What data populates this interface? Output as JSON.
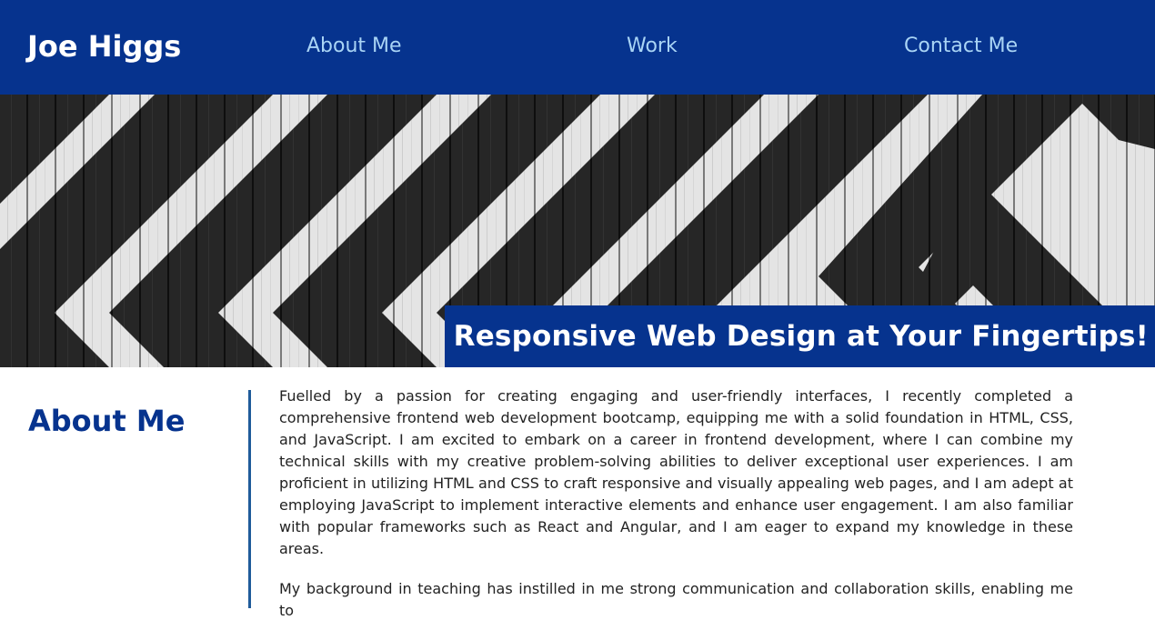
{
  "header": {
    "site_name": "Joe Higgs",
    "nav": {
      "about": "About Me",
      "work": "Work",
      "contact": "Contact Me"
    }
  },
  "hero": {
    "title": "Responsive Web Design at Your Fingertips!"
  },
  "about": {
    "heading": "About Me",
    "paragraphs": [
      "Fuelled by a passion for creating engaging and user-friendly interfaces, I recently completed a comprehensive frontend web development bootcamp, equipping me with a solid foundation in HTML, CSS, and JavaScript. I am excited to embark on a career in frontend development, where I can combine my technical skills with my creative problem-solving abilities to deliver exceptional user experiences. I am proficient in utilizing HTML and CSS to craft responsive and visually appealing web pages, and I am adept at employing JavaScript to implement interactive elements and enhance user engagement. I am also familiar with popular frameworks such as React and Angular, and I am eager to expand my knowledge in these areas.",
      "My background in teaching has instilled in me strong communication and collaboration skills, enabling me to"
    ]
  },
  "colors": {
    "header_bg": "#06338e",
    "nav_link": "#a9d4f5",
    "heading": "#06338e",
    "divider": "#1f5b9a"
  }
}
